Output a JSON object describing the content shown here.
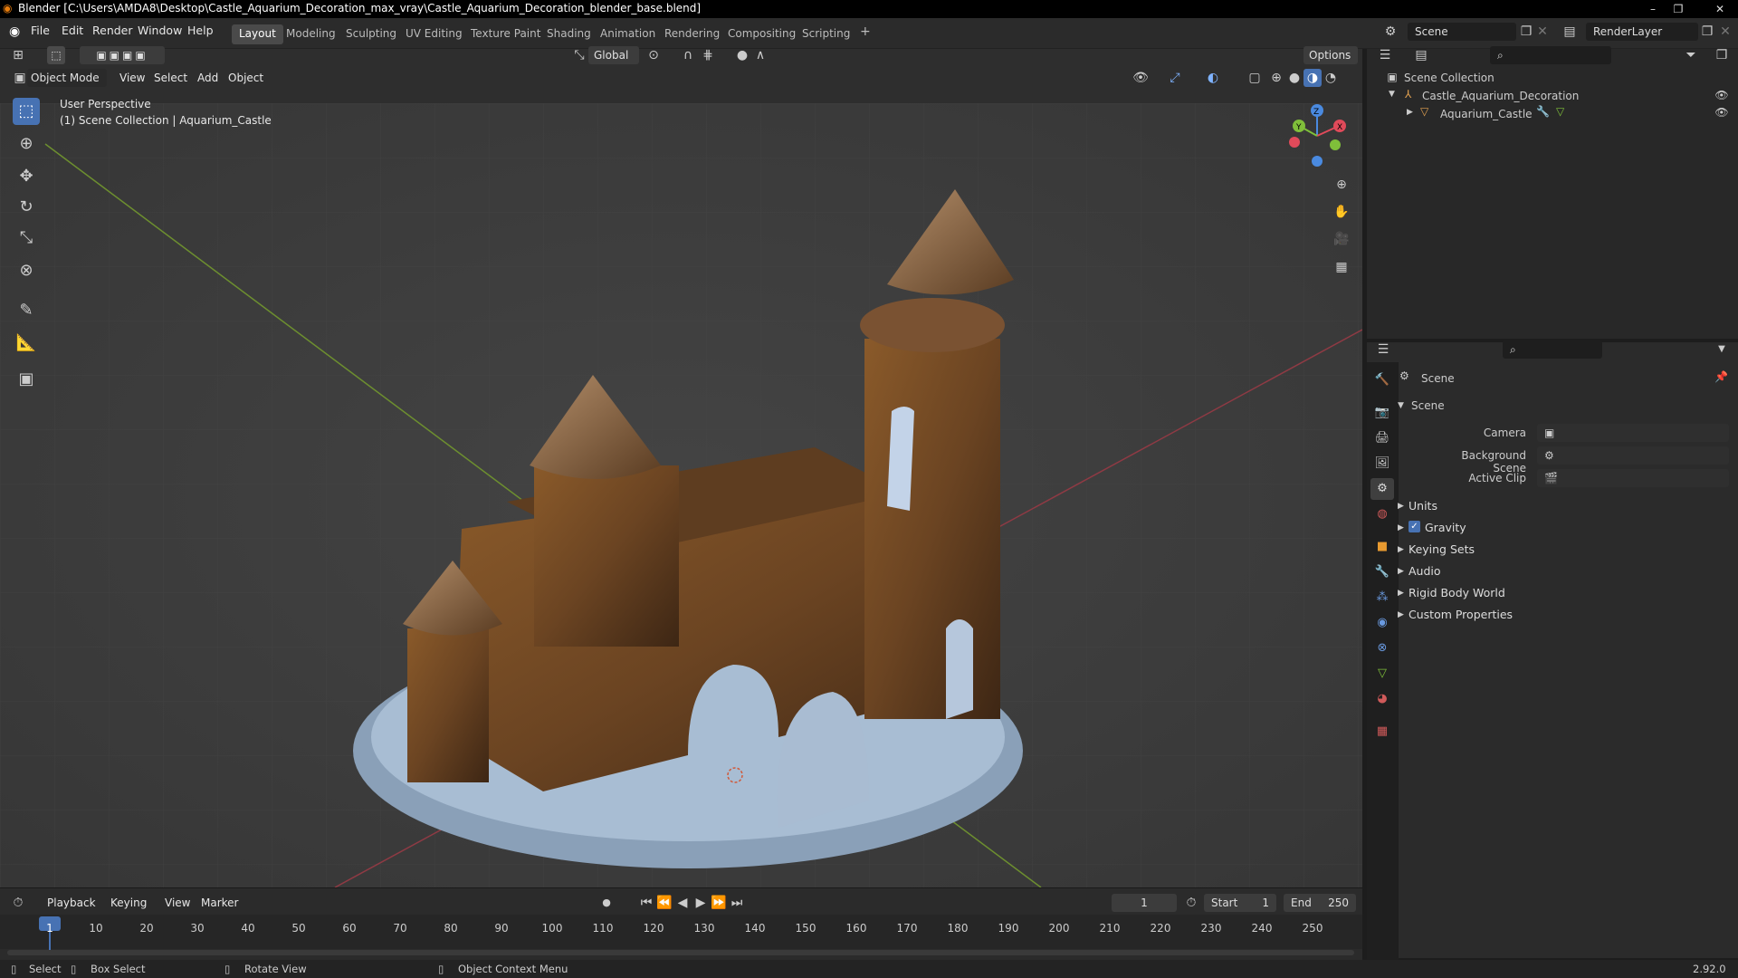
{
  "window": {
    "title": "Blender [C:\\Users\\AMDA8\\Desktop\\Castle_Aquarium_Decoration_max_vray\\Castle_Aquarium_Decoration_blender_base.blend]"
  },
  "menubar": {
    "items": [
      "File",
      "Edit",
      "Render",
      "Window",
      "Help"
    ]
  },
  "workspaces": {
    "tabs": [
      "Layout",
      "Modeling",
      "Sculpting",
      "UV Editing",
      "Texture Paint",
      "Shading",
      "Animation",
      "Rendering",
      "Compositing",
      "Scripting"
    ],
    "add": "+"
  },
  "scene_selector": {
    "scene": "Scene",
    "render_layer": "RenderLayer"
  },
  "viewport_header": {
    "mode": "Object Mode",
    "menus": [
      "View",
      "Select",
      "Add",
      "Object"
    ],
    "transform_orientation": "Global",
    "options": "Options"
  },
  "viewport": {
    "perspective": "User Perspective",
    "context": "(1) Scene Collection | Aquarium_Castle"
  },
  "gizmo": {
    "x": "X",
    "y": "Y",
    "z": "Z"
  },
  "outliner": {
    "root": "Scene Collection",
    "collection": "Castle_Aquarium_Decoration",
    "object": "Aquarium_Castle"
  },
  "properties": {
    "context": "Scene",
    "panel": "Scene",
    "fields": [
      {
        "label": "Camera",
        "value": ""
      },
      {
        "label": "Background Scene",
        "value": ""
      },
      {
        "label": "Active Clip",
        "value": ""
      }
    ],
    "sections": [
      "Units",
      "Gravity",
      "Keying Sets",
      "Audio",
      "Rigid Body World",
      "Custom Properties"
    ],
    "gravity_checked": true
  },
  "timeline": {
    "menus": [
      "Playback",
      "Keying",
      "View",
      "Marker"
    ],
    "current_frame": "1",
    "start_label": "Start",
    "start": "1",
    "end_label": "End",
    "end": "250",
    "ticks": [
      "1",
      "10",
      "20",
      "30",
      "40",
      "50",
      "60",
      "70",
      "80",
      "90",
      "100",
      "110",
      "120",
      "130",
      "140",
      "150",
      "160",
      "170",
      "180",
      "190",
      "200",
      "210",
      "220",
      "230",
      "240",
      "250"
    ]
  },
  "statusbar": {
    "select": "Select",
    "box_select": "Box Select",
    "rotate_view": "Rotate View",
    "context_menu": "Object Context Menu",
    "version": "2.92.0"
  },
  "colors": {
    "accent": "#4772b3",
    "x_axis": "#e04a5a",
    "y_axis": "#7fbf3a",
    "z_axis": "#4a8ae0"
  }
}
